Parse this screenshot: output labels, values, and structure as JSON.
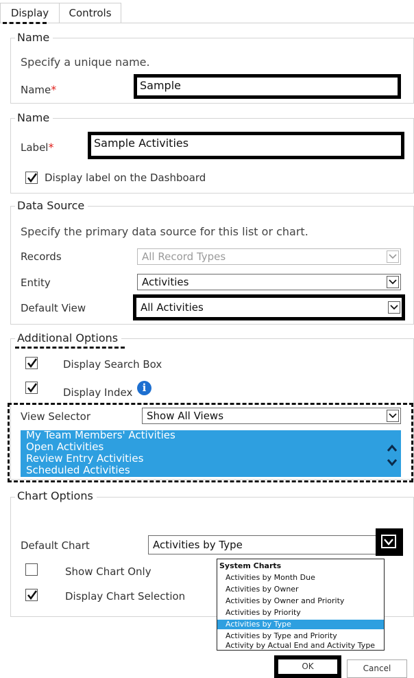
{
  "tabs": {
    "display": "Display",
    "controls": "Controls"
  },
  "name_section": {
    "legend": "Name",
    "description": "Specify a unique name.",
    "name_label": "Name",
    "required_mark": "*",
    "name_value": "Sample"
  },
  "label_section": {
    "legend": "Name",
    "label_label": "Label",
    "required_mark": "*",
    "label_value": "Sample Activities",
    "display_label_checkbox": "Display label on the Dashboard",
    "display_label_checked": true
  },
  "data_source": {
    "legend": "Data Source",
    "description": "Specify the primary data source for this list or chart.",
    "records_label": "Records",
    "records_value": "All Record Types",
    "entity_label": "Entity",
    "entity_value": "Activities",
    "default_view_label": "Default View",
    "default_view_value": "All Activities"
  },
  "additional_options": {
    "legend": "Additional Options",
    "display_search_box": "Display Search Box",
    "display_search_box_checked": true,
    "display_index": "Display Index",
    "display_index_checked": true,
    "info_icon_glyph": "i",
    "view_selector_label": "View Selector",
    "view_selector_value": "Show All Views",
    "views": [
      "My Team Members' Activities",
      "Open Activities",
      "Review Entry Activities",
      "Scheduled Activities"
    ]
  },
  "chart_options": {
    "legend": "Chart Options",
    "default_chart_label": "Default Chart",
    "default_chart_value": "Activities by Type",
    "show_chart_only": "Show Chart Only",
    "show_chart_only_checked": false,
    "display_chart_selection": "Display Chart Selection",
    "display_chart_selection_checked": true,
    "dropdown_header": "System Charts",
    "dropdown_items": [
      "Activities by Month Due",
      "Activities by Owner",
      "Activities by Owner and Priority",
      "Activities by Priority",
      "Activities by Type",
      "Activities by Type and Priority",
      "Activity by Actual End and Activity Type"
    ],
    "dropdown_selected": "Activities by Type"
  },
  "buttons": {
    "ok": "OK",
    "cancel": "Cancel"
  },
  "colors": {
    "selection_blue": "#2e9fe0",
    "info_blue": "#1d6fd0",
    "required_red": "#e0201c"
  }
}
